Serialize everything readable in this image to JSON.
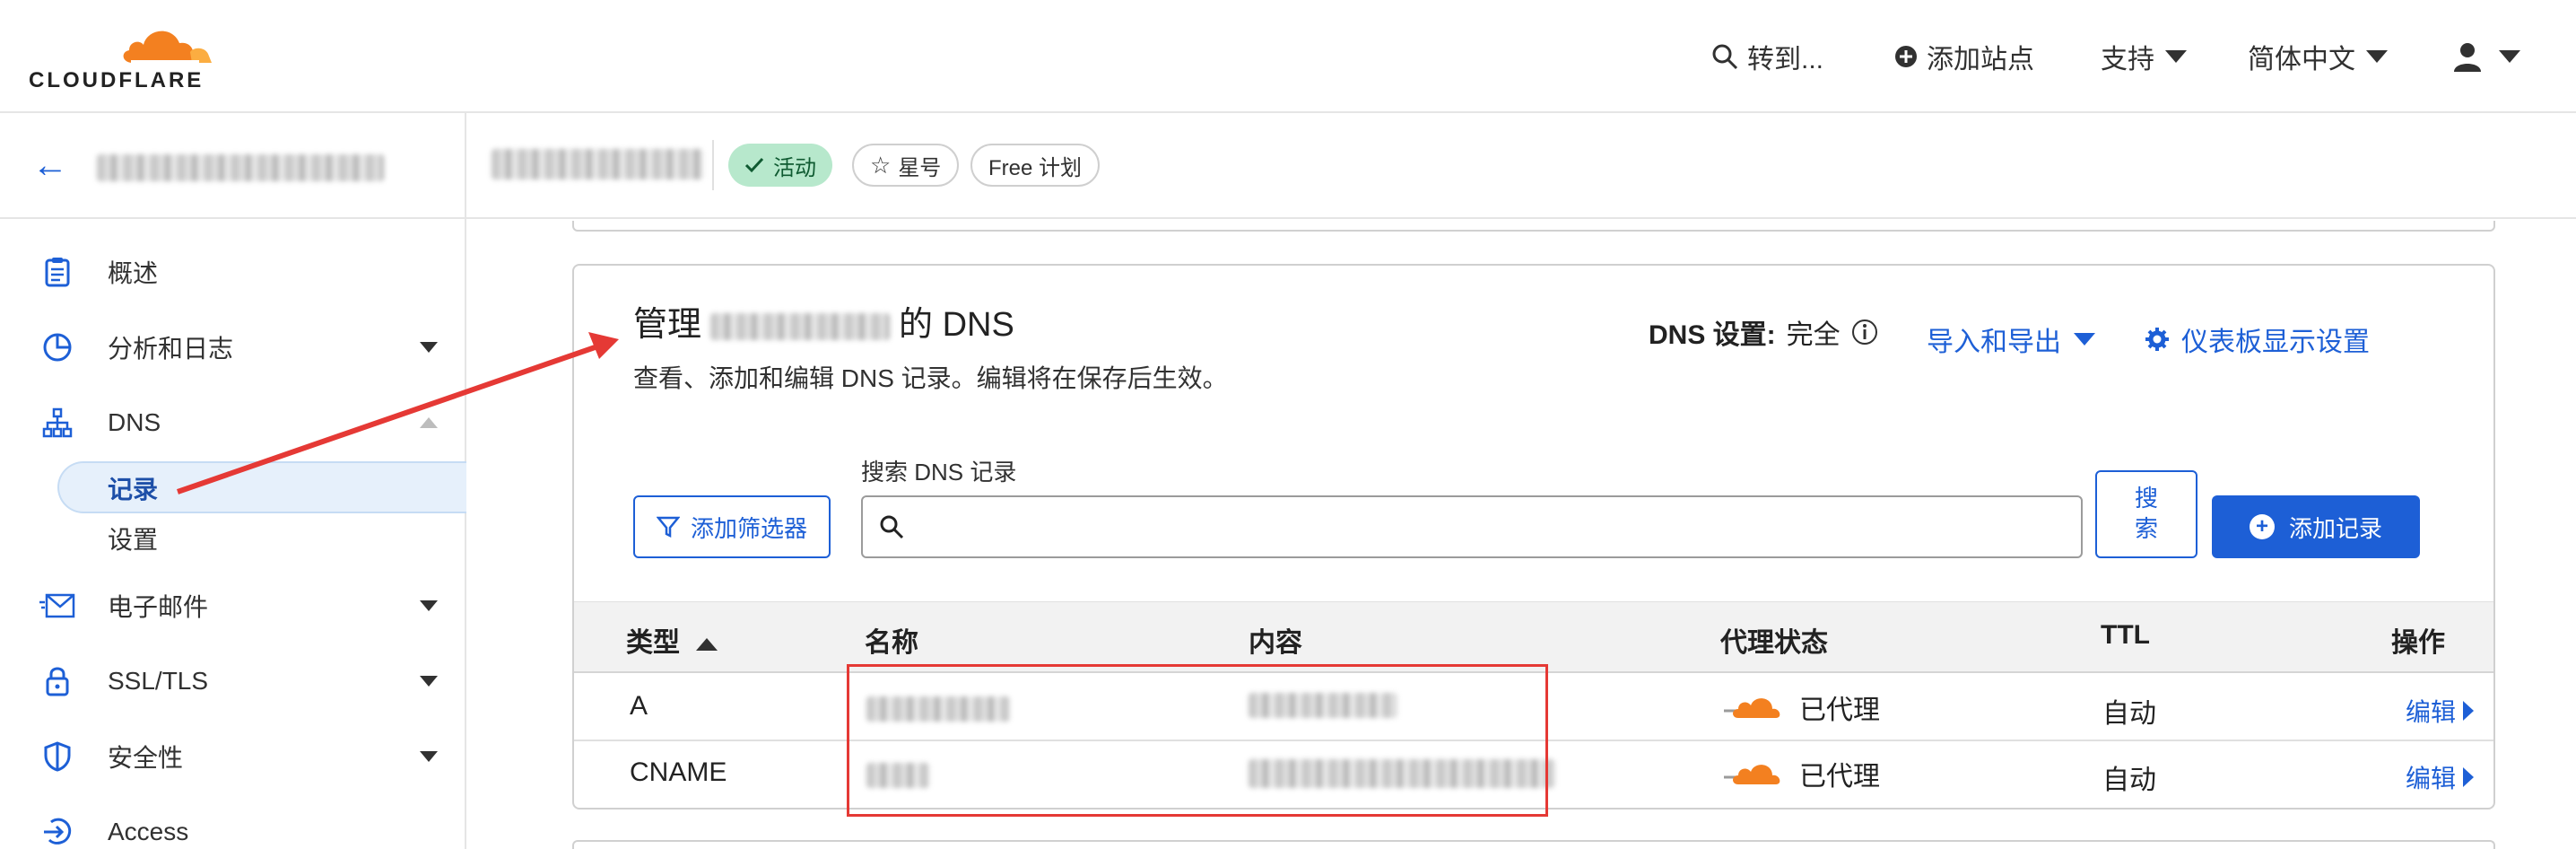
{
  "brand": {
    "logo_text": "CLOUDFLARE",
    "accent": "#f38020",
    "link_color": "#1d5fd6"
  },
  "topnav": {
    "goto_label": "转到...",
    "add_site_label": "添加站点",
    "support_label": "支持",
    "language_label": "简体中文"
  },
  "sidebar": {
    "items": [
      {
        "label": "概述",
        "icon": "clipboard-icon"
      },
      {
        "label": "分析和日志",
        "icon": "pie-chart-icon"
      },
      {
        "label": "DNS",
        "icon": "network-icon"
      },
      {
        "label": "电子邮件",
        "icon": "mail-icon"
      },
      {
        "label": "SSL/TLS",
        "icon": "lock-icon"
      },
      {
        "label": "安全性",
        "icon": "shield-icon"
      },
      {
        "label": "Access",
        "icon": "access-icon"
      }
    ],
    "dns_sub": [
      {
        "label": "记录",
        "active": true
      },
      {
        "label": "设置",
        "active": false
      }
    ]
  },
  "zone_header": {
    "status_label": "活动",
    "star_label": "星号",
    "plan_label": "Free 计划"
  },
  "dns_card": {
    "title_prefix": "管理",
    "title_suffix": "的 DNS",
    "description": "查看、添加和编辑 DNS 记录。编辑将在保存后生效。",
    "dns_setting_label": "DNS 设置:",
    "dns_setting_value": "完全",
    "import_export_label": "导入和导出",
    "dashboard_settings_label": "仪表板显示设置",
    "filter_button_label": "添加筛选器",
    "search_label": "搜索 DNS 记录",
    "search_value": "",
    "search_button_label": "搜\n索",
    "add_record_label": "添加记录"
  },
  "table": {
    "headers": {
      "type": "类型",
      "name": "名称",
      "content": "内容",
      "proxy": "代理状态",
      "ttl": "TTL",
      "actions": "操作"
    },
    "rows": [
      {
        "type": "A",
        "proxy": "已代理",
        "ttl": "自动",
        "edit": "编辑"
      },
      {
        "type": "CNAME",
        "proxy": "已代理",
        "ttl": "自动",
        "edit": "编辑"
      }
    ]
  },
  "annotation_colors": {
    "arrow": "#e53935",
    "box": "#e53935"
  }
}
